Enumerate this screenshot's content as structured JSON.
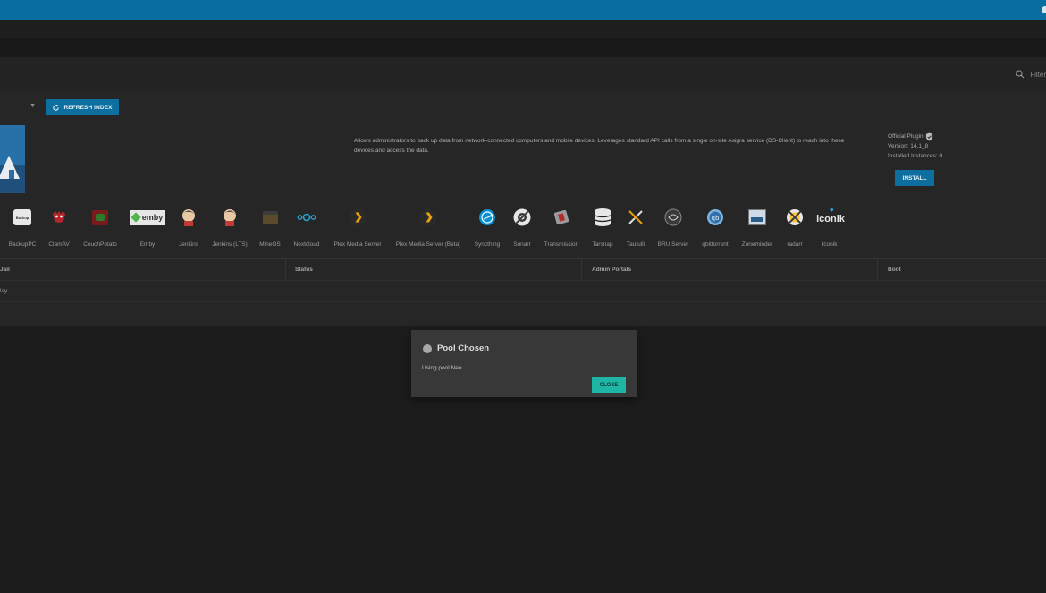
{
  "header": {
    "filter_placeholder": "Filter"
  },
  "toolbar": {
    "refresh_label": "REFRESH INDEX"
  },
  "selected_plugin": {
    "description": "Allows administrators to back up data from network-connected computers and mobile devices. Leverages standard API calls from a single on-site Asigra service (DS-Client) to reach into these devices and access the data.",
    "official_label": "Official Plugin",
    "version": "Version: 14.1_8",
    "installed": "Installed Instances: 0",
    "install_label": "INSTALL"
  },
  "plugins": [
    {
      "name": "BackupPC",
      "icon": "backuppc-icon"
    },
    {
      "name": "ClamAV",
      "icon": "clamav-icon"
    },
    {
      "name": "CouchPotato",
      "icon": "couchpotato-icon"
    },
    {
      "name": "Emby",
      "icon": "emby-icon",
      "logo_text": "emby"
    },
    {
      "name": "Jenkins",
      "icon": "jenkins-icon"
    },
    {
      "name": "Jenkins (LTS)",
      "icon": "jenkins-lts-icon"
    },
    {
      "name": "MineOS",
      "icon": "mineos-icon"
    },
    {
      "name": "Nextcloud",
      "icon": "nextcloud-icon"
    },
    {
      "name": "Plex Media Server",
      "icon": "plex-icon"
    },
    {
      "name": "Plex Media Server (Beta)",
      "icon": "plex-beta-icon"
    },
    {
      "name": "Syncthing",
      "icon": "syncthing-icon"
    },
    {
      "name": "Sonarr",
      "icon": "sonarr-icon"
    },
    {
      "name": "Transmission",
      "icon": "transmission-icon"
    },
    {
      "name": "Tarsnap",
      "icon": "tarsnap-icon"
    },
    {
      "name": "Tautulli",
      "icon": "tautulli-icon"
    },
    {
      "name": "BRU Server",
      "icon": "bru-server-icon"
    },
    {
      "name": "qbittorrent",
      "icon": "qbittorrent-icon"
    },
    {
      "name": "Zoneminder",
      "icon": "zoneminder-icon"
    },
    {
      "name": "radarr",
      "icon": "radarr-icon"
    },
    {
      "name": "Iconik",
      "icon": "iconik-icon",
      "logo_text": "iconik"
    }
  ],
  "backuppc_logo_text": "Backup",
  "jails_table": {
    "columns": [
      "Jail",
      "Status",
      "Admin Portals",
      "Boot"
    ],
    "row_text": "lay"
  },
  "dialog": {
    "title": "Pool Chosen",
    "message": "Using pool Neo",
    "close_label": "CLOSE"
  },
  "colors": {
    "topbar": "#0a6fa0",
    "primary_button": "#0e6ea0",
    "close_button": "#1fb5a4",
    "background": "#1c1c1c"
  }
}
